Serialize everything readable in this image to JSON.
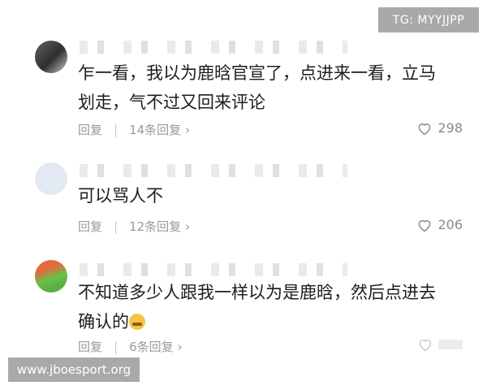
{
  "watermark_top": "TG: MYYJJPP",
  "watermark_bottom": "www.jboesport.org",
  "reply_label": "回复",
  "comments": [
    {
      "text_line1": "乍一看，我以为鹿晗官宣了，点进来一看，立马",
      "text_line2": "划走，气不过又回来评论",
      "replies": "14条回复",
      "likes": "298"
    },
    {
      "text_line1": "可以骂人不",
      "text_line2": "",
      "replies": "12条回复",
      "likes": "206"
    },
    {
      "text_line1": "不知道多少人跟我一样以为是鹿晗，然后点进去",
      "text_line2": "确认的",
      "replies": "6条回复",
      "likes": ""
    }
  ],
  "icons": {
    "chevron": "chevron-right-icon",
    "like": "heart-outline-icon",
    "emoji": "laughing-crying-emoji"
  }
}
